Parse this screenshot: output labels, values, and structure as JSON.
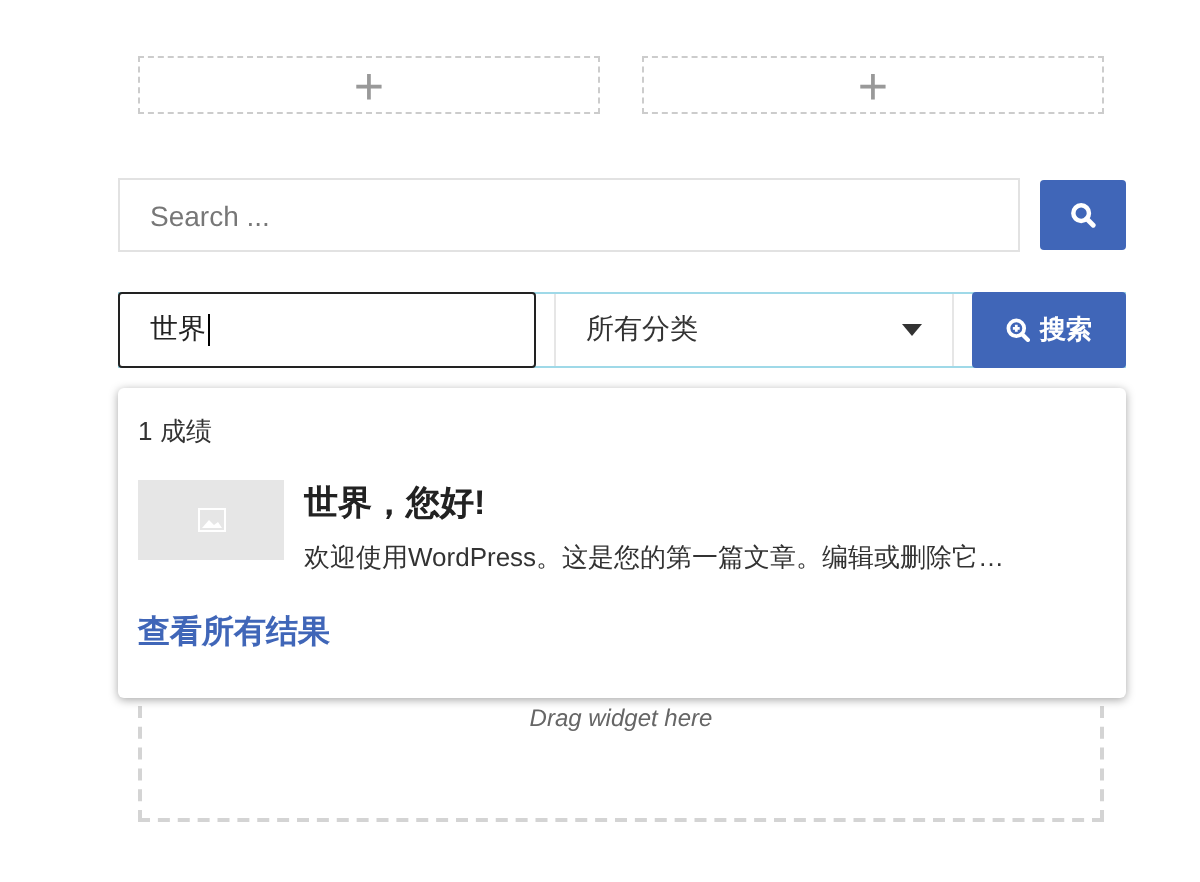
{
  "add_slots": [
    {
      "label": "+"
    },
    {
      "label": "+"
    }
  ],
  "search": {
    "placeholder": "Search ..."
  },
  "filter": {
    "value": "世界",
    "category": "所有分类",
    "button": "搜索"
  },
  "results": {
    "count": "1 成绩",
    "items": [
      {
        "title": "世界，您好!",
        "excerpt": "欢迎使用WordPress。这是您的第一篇文章。编辑或删除它…"
      }
    ],
    "view_all": "查看所有结果"
  },
  "dropzone": {
    "label": "Drag widget here"
  }
}
